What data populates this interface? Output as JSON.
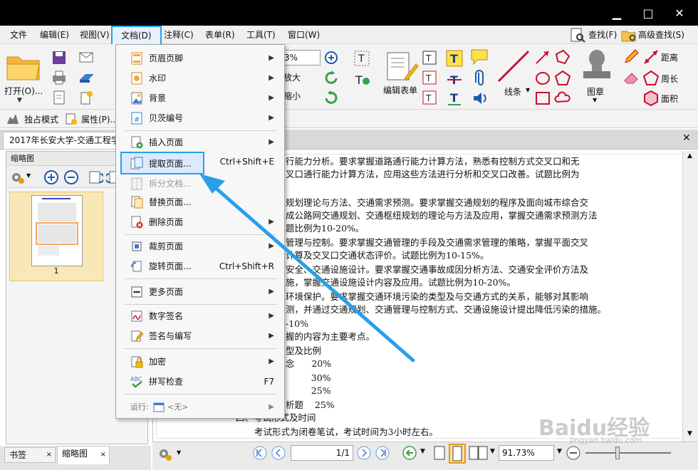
{
  "window": {
    "minimize": "▁",
    "maximize": "□",
    "close": "✕"
  },
  "menubar": {
    "items": [
      "文件",
      "编辑(E)",
      "视图(V)",
      "文档(D)",
      "注释(C)",
      "表单(R)",
      "工具(T)",
      "窗口(W)"
    ],
    "find": "查找(F)",
    "advanced_find": "高级查找(S)"
  },
  "toolbar": {
    "open_label": "打开(O)...",
    "zoom_value": "3%",
    "zoom_in_label": "放大",
    "zoom_out_label": "缩小",
    "edit_form_label": "编辑表单",
    "line_label": "线条",
    "stamp_label": "图章",
    "distance_label": "距离",
    "perimeter_label": "周长",
    "area_label": "面积"
  },
  "toolbar2": {
    "exclusive_mode": "独占模式",
    "properties": "属性(P)..."
  },
  "doc_tab": {
    "title": "2017年长安大学-交通工程学",
    "close": "✕"
  },
  "left_panel": {
    "title": "缩略图",
    "page_num": "1"
  },
  "bottom_tabs": {
    "bookmarks": "书签",
    "thumbnails": "缩略图",
    "close": "×"
  },
  "document": {
    "lines": [
      "行能力分析。要求掌握道路通行能力计算方法，熟悉有控制方式交叉口和无",
      "叉口通行能力计算方法，应用这些方法进行分析和交叉口改善。试题比例为",
      "规划理论与方法、交通需求预测。要求掌握交通规划的程序及面向城市综合交",
      "成公路网交通规划、交通枢纽规划的理论与方法及应用，掌握交通需求预测方法",
      "题比例为10-20%。",
      "管理与控制。要求掌握交通管理的手段及交通需求管理的策略，掌握平面交叉",
      "计算及交叉口交通状态评价。试题比例为10-15%。",
      "安全、交通设施设计。要求掌握交通事故成因分析方法、交通安全评价方法及",
      "施，掌握交通设施设计内容及应用。试题比例为10-20%。",
      "环境保护。要求掌握交通环境污染的类型及与交通方式的关系，能够对其影响",
      "测，并通过交通规划、交通管理与控制方式、交通设施设计提出降低污染的措施。",
      "-10%",
      "握的内容为主要考点。",
      "型及比例",
      "念      20%",
      "         30%",
      "         25%",
      "析题    25%",
      "四、考试形式及时间",
      "考试形式为闭卷笔试，考试时间为3小时左右。"
    ]
  },
  "statusbar": {
    "page_display": "1/1",
    "zoom_display": "91.73%"
  },
  "dropdown": {
    "items": [
      {
        "label": "页眉页脚",
        "submenu": true
      },
      {
        "label": "水印",
        "submenu": true
      },
      {
        "label": "背景",
        "submenu": true
      },
      {
        "label": "贝茨编号",
        "submenu": true
      },
      {
        "label": "插入页面",
        "submenu": true
      },
      {
        "label": "提取页面...",
        "shortcut": "Ctrl+Shift+E"
      },
      {
        "label": "拆分文档...",
        "disabled": true
      },
      {
        "label": "替换页面..."
      },
      {
        "label": "删除页面",
        "submenu": true
      },
      {
        "label": "裁剪页面",
        "submenu": true
      },
      {
        "label": "旋转页面...",
        "shortcut": "Ctrl+Shift+R"
      },
      {
        "label": "更多页面",
        "submenu": true
      },
      {
        "label": "数字签名",
        "submenu": true
      },
      {
        "label": "签名与编写",
        "submenu": true
      },
      {
        "label": "加密",
        "submenu": true
      },
      {
        "label": "拼写检查",
        "shortcut": "F7"
      }
    ],
    "run_label": "运行:",
    "run_value": "<无>",
    "submenu_arrow": "▶"
  },
  "watermark": {
    "logo": "Baidu经验",
    "url": "jingyan.baidu.com"
  },
  "colors": {
    "highlight": "#2a9fe8",
    "arrow": "#2a9fe8",
    "red_tools": "#c8102e"
  }
}
